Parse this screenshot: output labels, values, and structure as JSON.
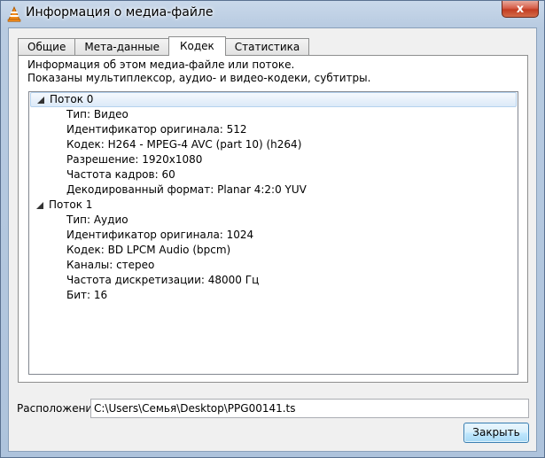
{
  "window": {
    "title": "Информация о медиа-файле",
    "close_glyph": "x"
  },
  "tabs": [
    {
      "label": "Общие"
    },
    {
      "label": "Мета-данные"
    },
    {
      "label": "Кодек"
    },
    {
      "label": "Статистика"
    }
  ],
  "active_tab": "Кодек",
  "panel": {
    "info_line1": "Информация об этом медиа-файле или потоке.",
    "info_line2": "Показаны мультиплексор, аудио- и видео-кодеки, субтитры."
  },
  "tree": {
    "streams": [
      {
        "label": "Поток 0",
        "properties": [
          "Тип: Видео",
          "Идентификатор оригинала: 512",
          "Кодек: H264 - MPEG-4 AVC (part 10) (h264)",
          "Разрешение: 1920x1080",
          "Частота кадров: 60",
          "Декодированный формат: Planar 4:2:0 YUV"
        ]
      },
      {
        "label": "Поток 1",
        "properties": [
          "Тип: Аудио",
          "Идентификатор оригинала: 1024",
          "Кодек: BD LPCM Audio (bpcm)",
          "Каналы: стерео",
          "Частота дискретизации: 48000 Гц",
          "Бит: 16"
        ]
      }
    ]
  },
  "location": {
    "label": "Расположение:",
    "value": "C:\\Users\\Семья\\Desktop\\PPG00141.ts"
  },
  "buttons": {
    "close_label": "Закрыть"
  },
  "icons": {
    "app": "vlc-cone-icon",
    "expand": "expand-arrow-icon"
  },
  "colors": {
    "selection": "#dceaf8",
    "close_red": "#c23d22"
  }
}
